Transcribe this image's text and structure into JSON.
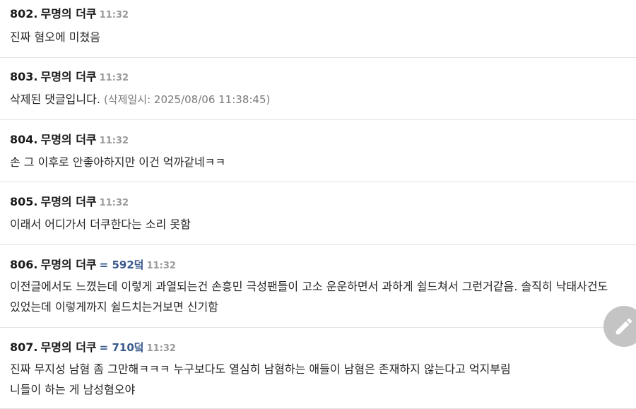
{
  "comments": [
    {
      "number": "802.",
      "author": "무명의 더쿠",
      "points": "",
      "time": "11:32",
      "lines": [
        "진짜 혐오에 미쳤음"
      ]
    },
    {
      "number": "803.",
      "author": "무명의 더쿠",
      "points": "",
      "time": "11:32",
      "lines": [
        "삭제된 댓글입니다."
      ],
      "deleted_meta": "(삭제일시: 2025/08/06 11:38:45)"
    },
    {
      "number": "804.",
      "author": "무명의 더쿠",
      "points": "",
      "time": "11:32",
      "lines": [
        "손 그 이후로 안좋아하지만 이건 억까같네ㅋㅋ"
      ]
    },
    {
      "number": "805.",
      "author": "무명의 더쿠",
      "points": "",
      "time": "11:32",
      "lines": [
        "이래서 어디가서 더쿠한다는 소리 못함"
      ]
    },
    {
      "number": "806.",
      "author": "무명의 더쿠",
      "points": "= 592덬",
      "time": "11:32",
      "lines": [
        "이전글에서도 느꼈는데 이렇게 과열되는건 손흥민 극성팬들이 고소 운운하면서 과하게 쉴드쳐서 그런거같음. 솔직히 낙태사건도",
        "있었는데 이렇게까지 쉴드치는거보면 신기함"
      ]
    },
    {
      "number": "807.",
      "author": "무명의 더쿠",
      "points": "= 710덬",
      "time": "11:32",
      "lines": [
        "진짜 무지성 남혐 좀 그만해ㅋㅋㅋ 누구보다도 열심히 남혐하는 애들이 남혐은 존재하지 않는다고 억지부림",
        "니들이 하는 게 남성혐오야"
      ]
    }
  ],
  "fab": {
    "icon": "pencil-icon"
  },
  "colors": {
    "points": "#3a5a8c",
    "time": "#9a9a9a",
    "divider": "#e2e2e2",
    "fab": "#c4c4c4"
  }
}
